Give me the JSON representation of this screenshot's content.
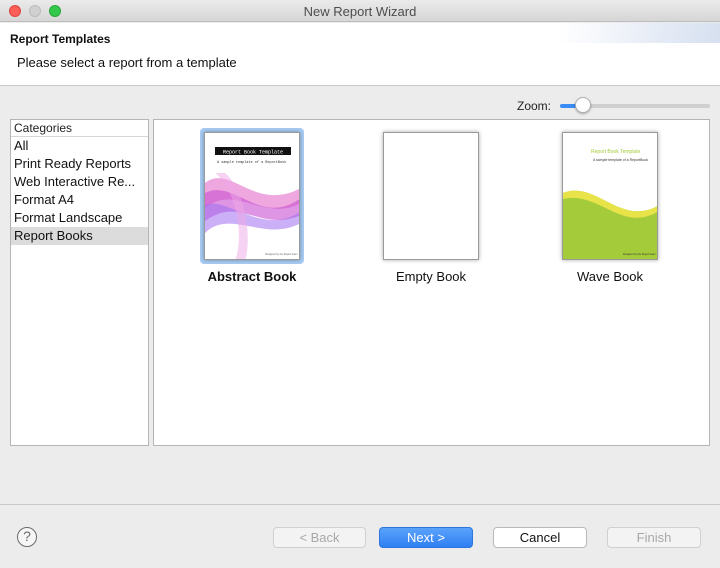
{
  "window": {
    "title": "New Report Wizard"
  },
  "header": {
    "title": "Report Templates",
    "message": "Please select a report from a template"
  },
  "zoom": {
    "label": "Zoom:",
    "level": 0.15
  },
  "categories": {
    "header": "Categories",
    "items": [
      {
        "label": "All",
        "selected": false
      },
      {
        "label": "Print Ready Reports",
        "selected": false
      },
      {
        "label": "Web Interactive Re...",
        "selected": false
      },
      {
        "label": "Format A4",
        "selected": false
      },
      {
        "label": "Format Landscape",
        "selected": false
      },
      {
        "label": "Report Books",
        "selected": true
      }
    ]
  },
  "templates": [
    {
      "label": "Abstract Book",
      "selected": true,
      "thumb_title": "Report Book Template",
      "thumb_subtitle": "A sample template of a ReportBook",
      "thumb_footer": "Designed by the Report team"
    },
    {
      "label": "Empty Book",
      "selected": false
    },
    {
      "label": "Wave Book",
      "selected": false,
      "thumb_title": "Report Book Template",
      "thumb_subtitle": "A sample template of a ReportBook",
      "thumb_footer": "Designed by the Report team"
    }
  ],
  "buttons": {
    "help": "?",
    "back": "< Back",
    "next": "Next >",
    "cancel": "Cancel",
    "finish": "Finish"
  },
  "colors": {
    "accent": "#3a8cf6",
    "selection": "#a9cdf5",
    "wave_green": "#a4cc3a"
  }
}
